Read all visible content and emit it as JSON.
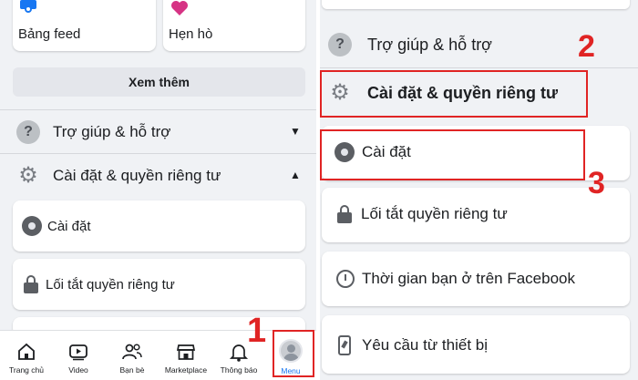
{
  "left_panel": {
    "tiles": [
      {
        "label": "Bảng feed",
        "icon": "feed-icon"
      },
      {
        "label": "Hẹn hò",
        "icon": "heart-icon"
      }
    ],
    "see_more_label": "Xem thêm",
    "help_label": "Trợ giúp & hỗ trợ",
    "settings_privacy_label": "Cài đặt & quyền riêng tư",
    "items": [
      {
        "label": "Cài đặt",
        "icon": "profile-icon"
      },
      {
        "label": "Lối tắt quyền riêng tư",
        "icon": "lock-icon"
      }
    ]
  },
  "tab_bar": {
    "tabs": [
      {
        "label": "Trang chủ",
        "icon": "home-icon"
      },
      {
        "label": "Video",
        "icon": "video-icon"
      },
      {
        "label": "Bạn bè",
        "icon": "friends-icon"
      },
      {
        "label": "Marketplace",
        "icon": "marketplace-icon"
      },
      {
        "label": "Thông báo",
        "icon": "bell-icon"
      },
      {
        "label": "Menu",
        "icon": "avatar",
        "active": true
      }
    ]
  },
  "right_panel": {
    "help_label": "Trợ giúp & hỗ trợ",
    "settings_privacy_label": "Cài đặt & quyền riêng tư",
    "items": [
      {
        "label": "Cài đặt",
        "icon": "profile-icon"
      },
      {
        "label": "Lối tắt quyền riêng tư",
        "icon": "lock-icon"
      },
      {
        "label": "Thời gian bạn ở trên Facebook",
        "icon": "clock-icon"
      },
      {
        "label": "Yêu cầu từ thiết bị",
        "icon": "phone-icon"
      }
    ]
  },
  "annotations": {
    "step1": "1",
    "step2": "2",
    "step3": "3"
  },
  "colors": {
    "highlight": "#e02424",
    "accent": "#1877f2",
    "background": "#f0f2f5"
  }
}
